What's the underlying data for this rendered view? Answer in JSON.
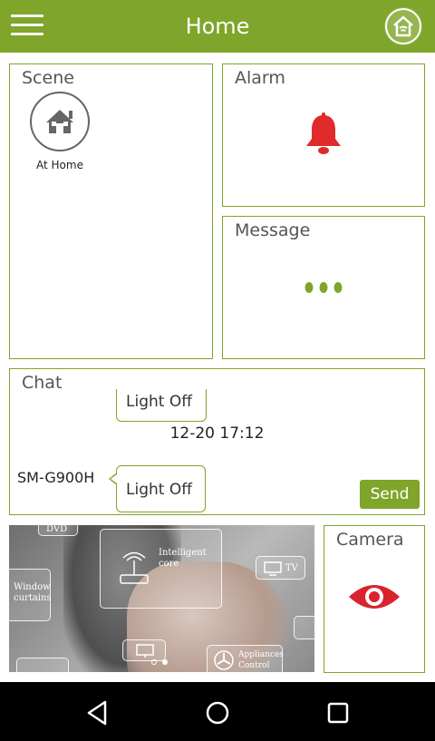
{
  "header": {
    "title": "Home",
    "menu_icon": "hamburger-menu-icon",
    "home_icon": "home-shield-icon"
  },
  "scene": {
    "label": "Scene",
    "items": [
      {
        "label": "At Home",
        "icon": "house-icon"
      }
    ]
  },
  "alarm": {
    "label": "Alarm",
    "icon": "bell-icon",
    "icon_color": "#e02b2b"
  },
  "message": {
    "label": "Message",
    "icon": "more-dots-icon",
    "icon_color": "#7fa52a"
  },
  "chat": {
    "label": "Chat",
    "earlier_message": "Light Off",
    "timestamp": "12-20 17:12",
    "sender": "SM-G900H",
    "latest_message": "Light Off",
    "send_label": "Send"
  },
  "banner": {
    "tiles": [
      "DVD",
      "Window curtains",
      "Intelligent core",
      "TV",
      "Appliances Control"
    ],
    "page_count": 2,
    "active_page": 2
  },
  "camera": {
    "label": "Camera",
    "icon": "eye-icon",
    "icon_color": "#d9232d"
  },
  "nav": {
    "back_icon": "back-triangle-icon",
    "home_icon": "home-circle-icon",
    "recents_icon": "recents-square-icon"
  },
  "colors": {
    "accent": "#7fa52a",
    "alarm": "#e02b2b",
    "camera": "#d9232d"
  }
}
